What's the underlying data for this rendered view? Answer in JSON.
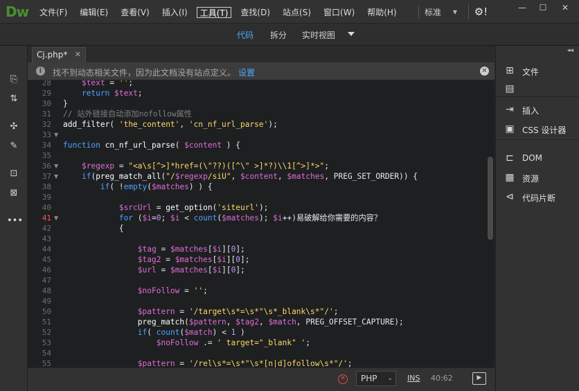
{
  "app": {
    "logo": "Dw"
  },
  "menubar": {
    "items": [
      "文件(F)",
      "编辑(E)",
      "查看(V)",
      "插入(I)",
      "工具(T)",
      "查找(D)",
      "站点(S)",
      "窗口(W)",
      "帮助(H)"
    ],
    "active_index": 4,
    "layout_label": "标准",
    "settings_label": "⚙!",
    "window_buttons": [
      "—",
      "☐",
      "✕"
    ]
  },
  "viewbar": {
    "code": "代码",
    "split": "拆分",
    "live": "实时视图"
  },
  "document": {
    "tab_label": "Cj.php*",
    "tab_close": "✕"
  },
  "notification": {
    "text": "找不到动态相关文件，因为此文档没有站点定义。",
    "link": "设置"
  },
  "editor": {
    "current_line": "41",
    "lines": [
      {
        "n": "28",
        "fold": "",
        "code": "    <span class=\"v\">$text</span> = <span class=\"s\">''</span>;"
      },
      {
        "n": "29",
        "fold": "",
        "code": "    <span class=\"k\">return</span> <span class=\"v\">$text</span>;"
      },
      {
        "n": "30",
        "fold": "",
        "code": "}"
      },
      {
        "n": "31",
        "fold": "",
        "code": "<span class=\"c\">// 站外链接自动添加nofollow属性</span>"
      },
      {
        "n": "32",
        "fold": "",
        "code": "<span class=\"f\">add_filter</span>( <span class=\"s\">'the_content'</span>, <span class=\"s\">'cn_nf_url_parse'</span>);"
      },
      {
        "n": "33",
        "fold": "▼",
        "code": ""
      },
      {
        "n": "34",
        "fold": "",
        "code": "<span class=\"k\">function</span> <span class=\"f\">cn_nf_url_parse</span>( <span class=\"v\">$content</span> ) {"
      },
      {
        "n": "35",
        "fold": "",
        "code": ""
      },
      {
        "n": "36",
        "fold": "▼",
        "code": "    <span class=\"v\">$regexp</span> = <span class=\"s\">\"&lt;a\\s[^&gt;]*href=(\\\"??)([^\\\" &gt;]*?)\\\\1[^&gt;]*&gt;\"</span>;"
      },
      {
        "n": "37",
        "fold": "▼",
        "code": "    <span class=\"k\">if</span>(<span class=\"f\">preg_match_all</span>(<span class=\"s\">\"/</span><span class=\"v\">$regexp</span><span class=\"s\">/siU\"</span>, <span class=\"v\">$content</span>, <span class=\"v\">$matches</span>, PREG_SET_ORDER)) {"
      },
      {
        "n": "38",
        "fold": "",
        "code": "        <span class=\"k\">if</span>( !<span class=\"k\">empty</span>(<span class=\"v\">$matches</span>) ) {"
      },
      {
        "n": "39",
        "fold": "",
        "code": ""
      },
      {
        "n": "40",
        "fold": "",
        "code": "            <span class=\"v\">$srcUrl</span> = <span class=\"f\">get_option</span>(<span class=\"s\">'siteurl'</span>);"
      },
      {
        "n": "41",
        "fold": "▼",
        "code": "            <span class=\"k\">for</span> (<span class=\"v\">$i</span>=<span class=\"n\">0</span>; <span class=\"v\">$i</span> &lt; <span class=\"k\">count</span>(<span class=\"v\">$matches</span>); <span class=\"v\">$i</span>++)易破解给你需要的内容？"
      },
      {
        "n": "42",
        "fold": "",
        "code": "            {"
      },
      {
        "n": "43",
        "fold": "",
        "code": ""
      },
      {
        "n": "44",
        "fold": "",
        "code": "                <span class=\"v\">$tag</span> = <span class=\"v\">$matches</span>[<span class=\"v\">$i</span>][<span class=\"n\">0</span>];"
      },
      {
        "n": "45",
        "fold": "",
        "code": "                <span class=\"v\">$tag2</span> = <span class=\"v\">$matches</span>[<span class=\"v\">$i</span>][<span class=\"n\">0</span>];"
      },
      {
        "n": "46",
        "fold": "",
        "code": "                <span class=\"v\">$url</span> = <span class=\"v\">$matches</span>[<span class=\"v\">$i</span>][<span class=\"n\">0</span>];"
      },
      {
        "n": "47",
        "fold": "",
        "code": ""
      },
      {
        "n": "48",
        "fold": "",
        "code": "                <span class=\"v\">$noFollow</span> = <span class=\"s\">''</span>;"
      },
      {
        "n": "49",
        "fold": "",
        "code": ""
      },
      {
        "n": "50",
        "fold": "",
        "code": "                <span class=\"v\">$pattern</span> = <span class=\"s\">'/target\\s*=\\s*\"\\s*_blank\\s*\"/'</span>;"
      },
      {
        "n": "51",
        "fold": "",
        "code": "                <span class=\"f\">preg_match</span>(<span class=\"v\">$pattern</span>, <span class=\"v\">$tag2</span>, <span class=\"v\">$match</span>, PREG_OFFSET_CAPTURE);"
      },
      {
        "n": "52",
        "fold": "",
        "code": "                <span class=\"k\">if</span>( <span class=\"k\">count</span>(<span class=\"v\">$match</span>) &lt; <span class=\"n\">1</span> )"
      },
      {
        "n": "53",
        "fold": "",
        "code": "                    <span class=\"v\">$noFollow</span> .= <span class=\"s\">' target=\"_blank\" '</span>;"
      },
      {
        "n": "54",
        "fold": "",
        "code": ""
      },
      {
        "n": "55",
        "fold": "",
        "code": "                <span class=\"v\">$pattern</span> = <span class=\"s\">'/rel\\s*=\\s*\"\\s*[n|d]ofollow\\s*\"/'</span>;"
      }
    ]
  },
  "status": {
    "error_icon": "error-icon",
    "language": "PHP",
    "insert_mode": "INS",
    "cursor": "40:62"
  },
  "panel": {
    "items": [
      {
        "icon": "sitemap-icon",
        "glyph": "⊞",
        "label": "文件"
      },
      {
        "icon": "assets-icon",
        "glyph": "▤",
        "label": ""
      },
      {
        "icon": "insert-icon",
        "glyph": "⇥",
        "label": "插入"
      },
      {
        "icon": "css-designer-icon",
        "glyph": "▣",
        "label": "CSS 设计器"
      },
      {
        "icon": "dom-icon",
        "glyph": "⊏",
        "label": "DOM"
      },
      {
        "icon": "assets-briefcase-icon",
        "glyph": "▦",
        "label": "资源"
      },
      {
        "icon": "snippets-icon",
        "glyph": "⊲",
        "label": "代码片断"
      }
    ]
  }
}
